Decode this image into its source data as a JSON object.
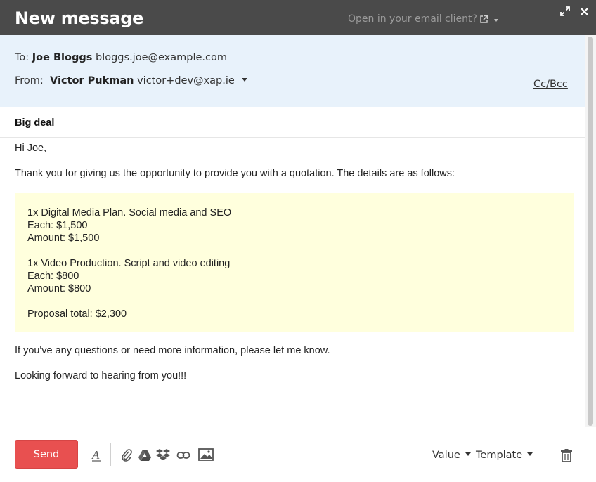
{
  "window": {
    "title": "New message",
    "open_in_client": "Open in your email client?"
  },
  "recipients": {
    "to_label": "To:",
    "to_name": "Joe Bloggs",
    "to_email": "bloggs.joe@example.com",
    "from_label": "From:",
    "from_name": "Victor Pukman",
    "from_email": "victor+dev@xap.ie",
    "cc_bcc": "Cc/Bcc"
  },
  "subject": "Big deal",
  "body": {
    "greeting": "Hi Joe,",
    "intro": "Thank you for giving us the opportunity to provide you with a quotation. The details are as follows:",
    "items": [
      {
        "title": "1x Digital Media Plan. Social media and SEO",
        "each": "Each: $1,500",
        "amount": "Amount: $1,500"
      },
      {
        "title": "1x Video Production. Script and video editing",
        "each": "Each: $800",
        "amount": "Amount: $800"
      }
    ],
    "total": "Proposal total: $2,300",
    "questions": "If you've any questions or need more information, please let me know.",
    "closing": "Looking forward to hearing from you!!!"
  },
  "toolbar": {
    "send_label": "Send",
    "value_label": "Value",
    "template_label": "Template",
    "icons": [
      "font-format-icon",
      "paperclip-icon",
      "google-drive-icon",
      "dropbox-icon",
      "link-icon",
      "image-icon",
      "trash-icon"
    ]
  },
  "colors": {
    "titlebar": "#4a4a4a",
    "header_bg": "#e8f2fb",
    "quote_bg": "#ffffdd",
    "send_button": "#e85050"
  }
}
